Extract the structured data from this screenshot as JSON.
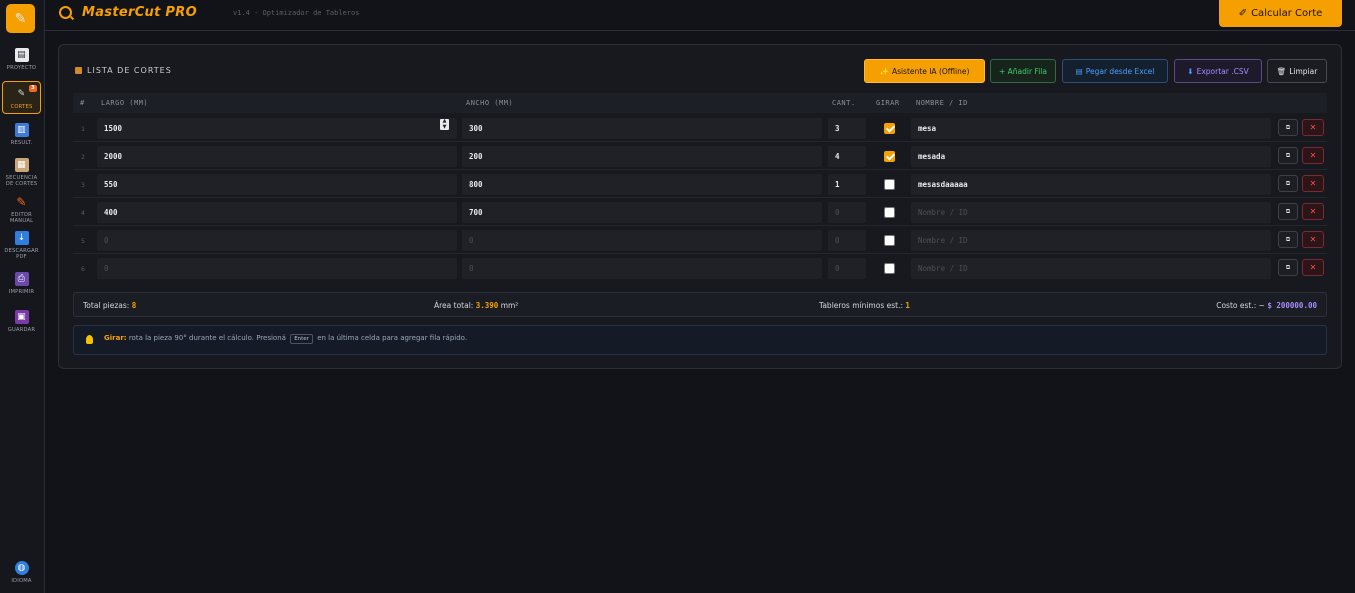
{
  "sidebar": {
    "items": [
      {
        "label": "PROYECTO",
        "icon": "document-icon"
      },
      {
        "label": "CORTES",
        "icon": "saw-icon",
        "badge": "3",
        "active": true
      },
      {
        "label": "RESULT.",
        "icon": "chart-icon"
      },
      {
        "label": "SECUENCIA DE CORTES",
        "icon": "clipboard-icon"
      },
      {
        "label": "EDITOR MANUAL",
        "icon": "pencil-icon"
      },
      {
        "label": "DESCARGAR PDF",
        "icon": "download-icon"
      },
      {
        "label": "IMPRIMIR",
        "icon": "printer-icon"
      },
      {
        "label": "GUARDAR",
        "icon": "save-icon"
      }
    ],
    "language_label": "IDIOMA"
  },
  "header": {
    "brand": "MasterCut PRO",
    "version": "v1.4 - Optimizador de Tableros",
    "calc_button": "Calcular Corte"
  },
  "panel": {
    "title": "LISTA DE CORTES",
    "buttons": {
      "ai": "Asistente IA (Offline)",
      "add_row": "+ Añadir Fila",
      "paste": "Pegar desde Excel",
      "export": "Exportar .CSV",
      "clear": "Limpiar"
    },
    "columns": {
      "num": "#",
      "largo": "LARGO (MM)",
      "ancho": "ANCHO (MM)",
      "cant": "CANT.",
      "girar": "GIRAR",
      "nombre": "NOMBRE / ID"
    },
    "rows": [
      {
        "n": "1",
        "largo": "1500",
        "ancho": "300",
        "cant": "3",
        "girar": true,
        "nombre": "mesa"
      },
      {
        "n": "2",
        "largo": "2000",
        "ancho": "200",
        "cant": "4",
        "girar": true,
        "nombre": "mesada"
      },
      {
        "n": "3",
        "largo": "550",
        "ancho": "800",
        "cant": "1",
        "girar": false,
        "nombre": "mesasdaaaaa"
      },
      {
        "n": "4",
        "largo": "400",
        "ancho": "700",
        "cant": "",
        "girar": false,
        "nombre": ""
      },
      {
        "n": "5",
        "largo": "",
        "ancho": "",
        "cant": "",
        "girar": false,
        "nombre": ""
      },
      {
        "n": "6",
        "largo": "",
        "ancho": "",
        "cant": "",
        "girar": false,
        "nombre": ""
      }
    ],
    "placeholders": {
      "largo": "0",
      "ancho": "0",
      "cant": "0",
      "nombre": "Nombre / ID"
    },
    "summary": {
      "total_label": "Total piezas:",
      "total_value": "8",
      "area_label": "Área total:",
      "area_value": "3.390",
      "area_unit": "mm²",
      "boards_label": "Tableros mínimos est.:",
      "boards_value": "1",
      "cost_label": "Costo est.: ~",
      "cost_value": "$ 200000.00"
    },
    "tip": {
      "bold": "Girar:",
      "text1": "rota la pieza 90° durante el cálculo. Presioná",
      "key": "Enter",
      "text2": "en la última celda para agregar fila rápido."
    }
  },
  "colors": {
    "accent": "#f5a000",
    "background": "#121318",
    "danger": "#ff4a4a",
    "purple": "#a98bff",
    "green": "#3ccf6b",
    "blue": "#4a9fff"
  }
}
